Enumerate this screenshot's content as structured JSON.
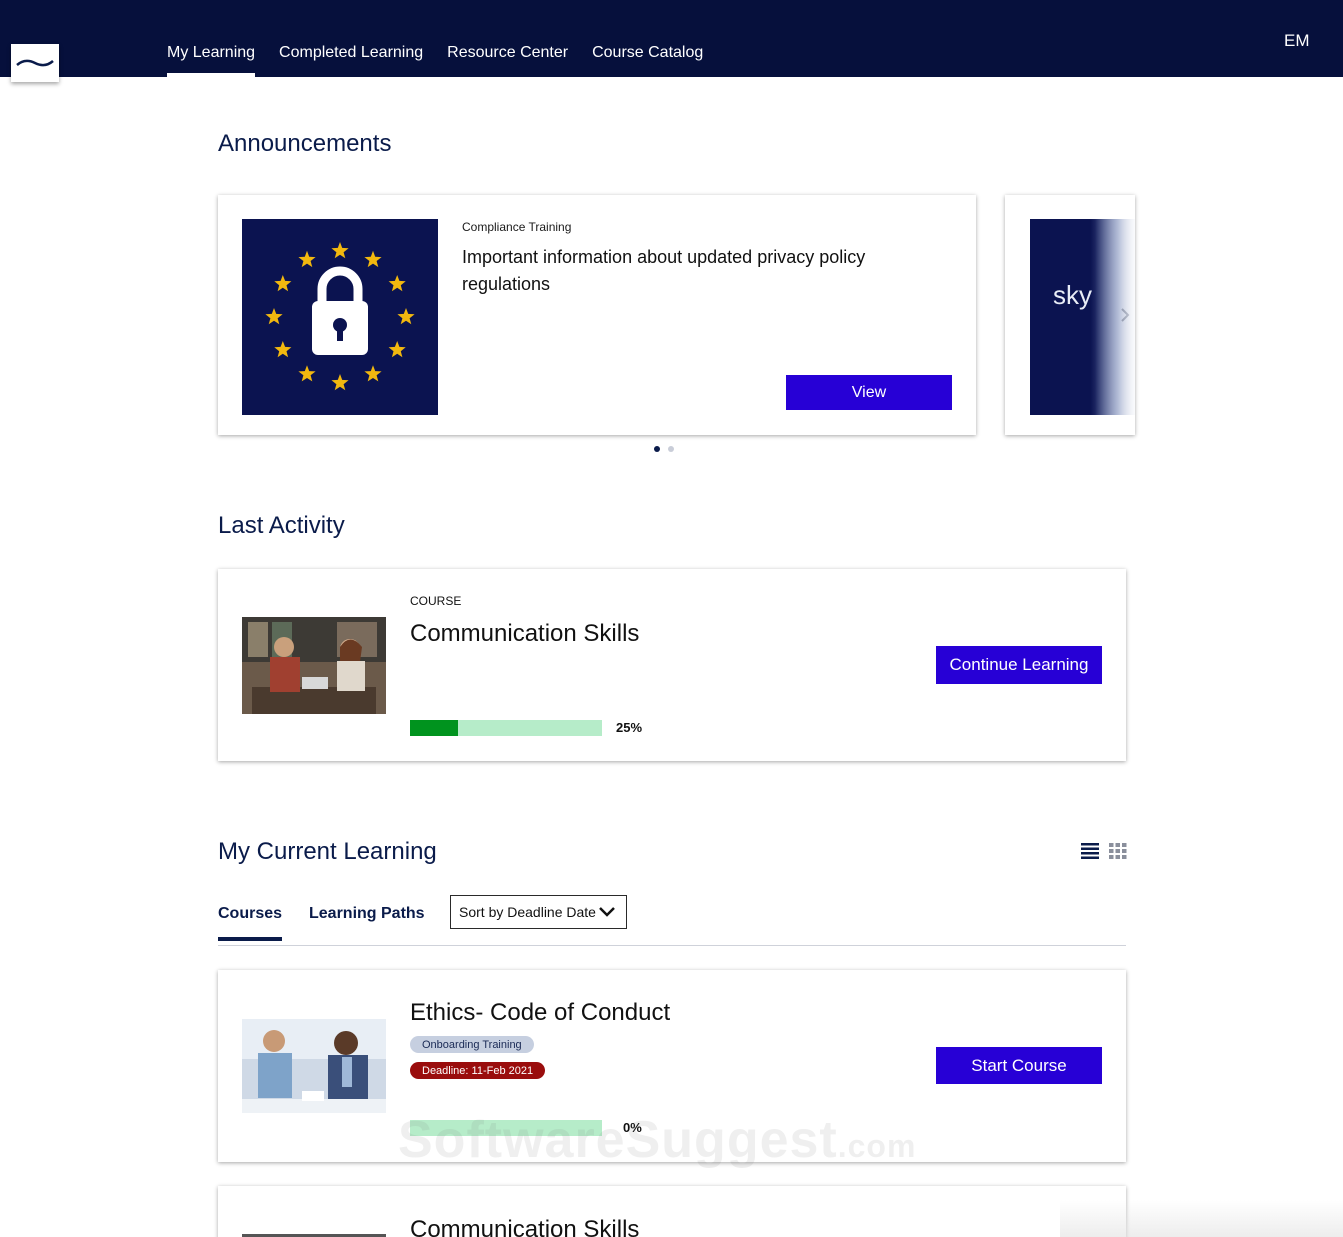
{
  "header": {
    "nav": [
      {
        "label": "My Learning",
        "active": true
      },
      {
        "label": "Completed Learning",
        "active": false
      },
      {
        "label": "Resource Center",
        "active": false
      },
      {
        "label": "Course Catalog",
        "active": false
      }
    ],
    "user_initials": "EM",
    "background_color": "#06103c"
  },
  "announcements": {
    "title": "Announcements",
    "cards": [
      {
        "category": "Compliance Training",
        "title": "Important information about updated privacy policy regulations",
        "button": "View",
        "image": "eu-privacy-lock-icon"
      }
    ],
    "peek_card_text": "sky",
    "pager_dots": 2,
    "pager_active": 1
  },
  "last_activity": {
    "title": "Last Activity",
    "type": "COURSE",
    "course_title": "Communication Skills",
    "progress": 25,
    "progress_label": "25%",
    "button": "Continue Learning"
  },
  "current_learning": {
    "title": "My Current Learning",
    "tabs": [
      {
        "label": "Courses",
        "active": true
      },
      {
        "label": "Learning Paths",
        "active": false
      }
    ],
    "sort": {
      "selected": "Sort by Deadline Date"
    },
    "courses": [
      {
        "title": "Ethics- Code of Conduct",
        "category": "Onboarding Training",
        "deadline": "Deadline: 11-Feb 2021",
        "progress": 0,
        "progress_label": "0%",
        "button": "Start Course"
      },
      {
        "title": "Communication Skills"
      }
    ]
  },
  "watermark": {
    "main": "SoftwareSuggest",
    "suffix": ".com"
  },
  "colors": {
    "accent": "#2700d6",
    "progress_fill": "#00931e",
    "progress_track": "#b6ecc9",
    "deadline": "#9a0d0d",
    "navy": "#0a1b4a"
  }
}
